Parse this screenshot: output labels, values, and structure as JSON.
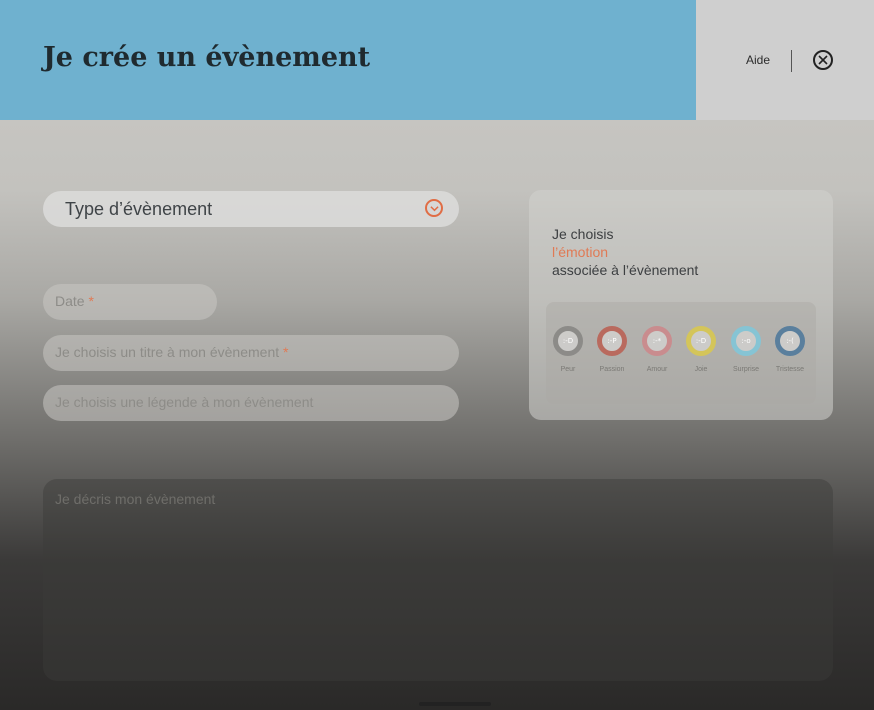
{
  "header": {
    "title": "Je crée un évènement",
    "help_label": "Aide",
    "close_icon": "close-circle-icon"
  },
  "form": {
    "type_select": {
      "label": "Type d’évènement",
      "icon": "chevron-down-circle-icon"
    },
    "date": {
      "placeholder": "Date",
      "required_mark": "*"
    },
    "title": {
      "placeholder": "Je choisis un titre à mon évènement",
      "required_mark": "*"
    },
    "legend": {
      "placeholder": "Je choisis une légende à mon évènement"
    },
    "description": {
      "placeholder": "Je décris mon évènement"
    }
  },
  "emotion_picker": {
    "prompt_line1": "Je choisis",
    "prompt_accent": "l’émotion",
    "prompt_line3": "associée à l’évènement",
    "emotions": [
      {
        "label": "Peur",
        "face": ":-D",
        "color": "#8c8b88"
      },
      {
        "label": "Passion",
        "face": ":-P",
        "color": "#b96a5e"
      },
      {
        "label": "Amour",
        "face": ":-*",
        "color": "#c98c8e"
      },
      {
        "label": "Joie",
        "face": ":-D",
        "color": "#d4c55a"
      },
      {
        "label": "Surprise",
        "face": ":-o",
        "color": "#86c4d4"
      },
      {
        "label": "Tristesse",
        "face": ":-(",
        "color": "#5a7f9d"
      }
    ]
  },
  "colors": {
    "header_blue": "#6fb1cf",
    "accent_orange": "#e07a55"
  }
}
